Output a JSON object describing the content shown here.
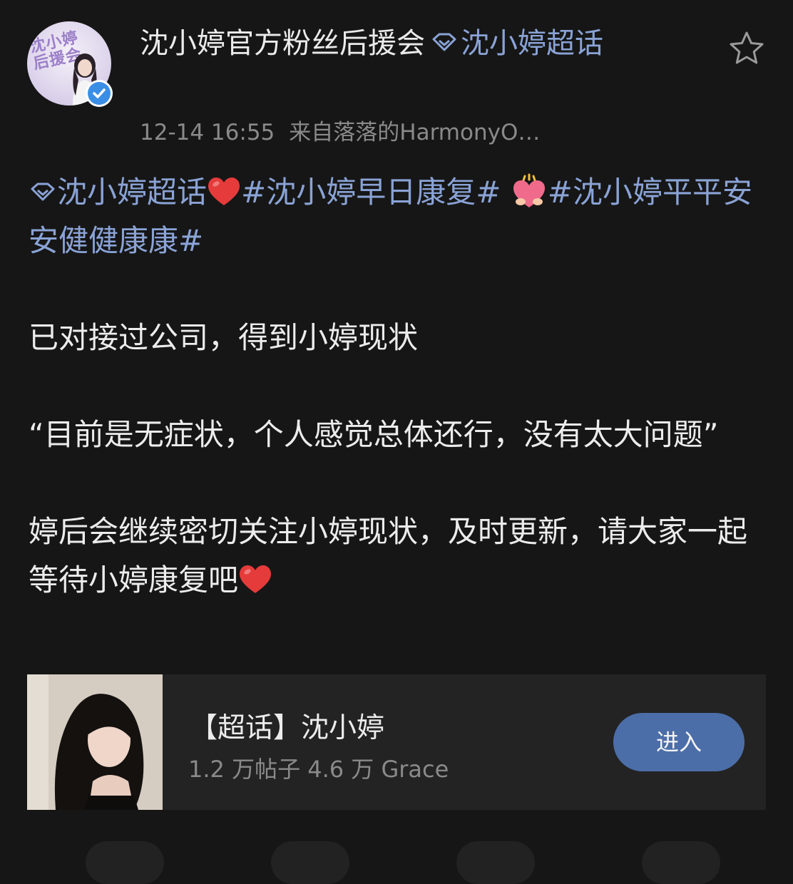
{
  "header": {
    "author_name": "沈小婷官方粉丝后援会",
    "topic_label": "沈小婷超话",
    "timestamp": "12-14 16:55",
    "source": "来自落落的HarmonyO…",
    "avatar_text_line1": "沈小婷",
    "avatar_text_line2": "后援会"
  },
  "post": {
    "topic_label": "沈小婷超话",
    "hashtag_1": "#沈小婷早日康复#",
    "hashtag_2": "#沈小婷平平安安健健康康#",
    "paragraph_1": "已对接过公司，得到小婷现状",
    "paragraph_2": "“目前是无症状，个人感觉总体还行，没有太大问题”",
    "paragraph_3": "婷后会继续密切关注小婷现状，及时更新，请大家一起等待小婷康复吧"
  },
  "card": {
    "title": "【超话】沈小婷",
    "stats": "1.2 万帖子  4.6 万 Grace",
    "button_label": "进入"
  },
  "colors": {
    "background": "#161616",
    "topic_link": "#8aa3d6",
    "button": "#4b6ea8",
    "verified": "#3b8ee6",
    "heart": "#e53b3b"
  },
  "icons": {
    "topic": "diamond-icon",
    "favorite": "star-icon",
    "verified": "verified-check-icon",
    "emoji_1": "red-heart-emoji-icon",
    "emoji_2": "hugging-heart-emoji-icon"
  }
}
